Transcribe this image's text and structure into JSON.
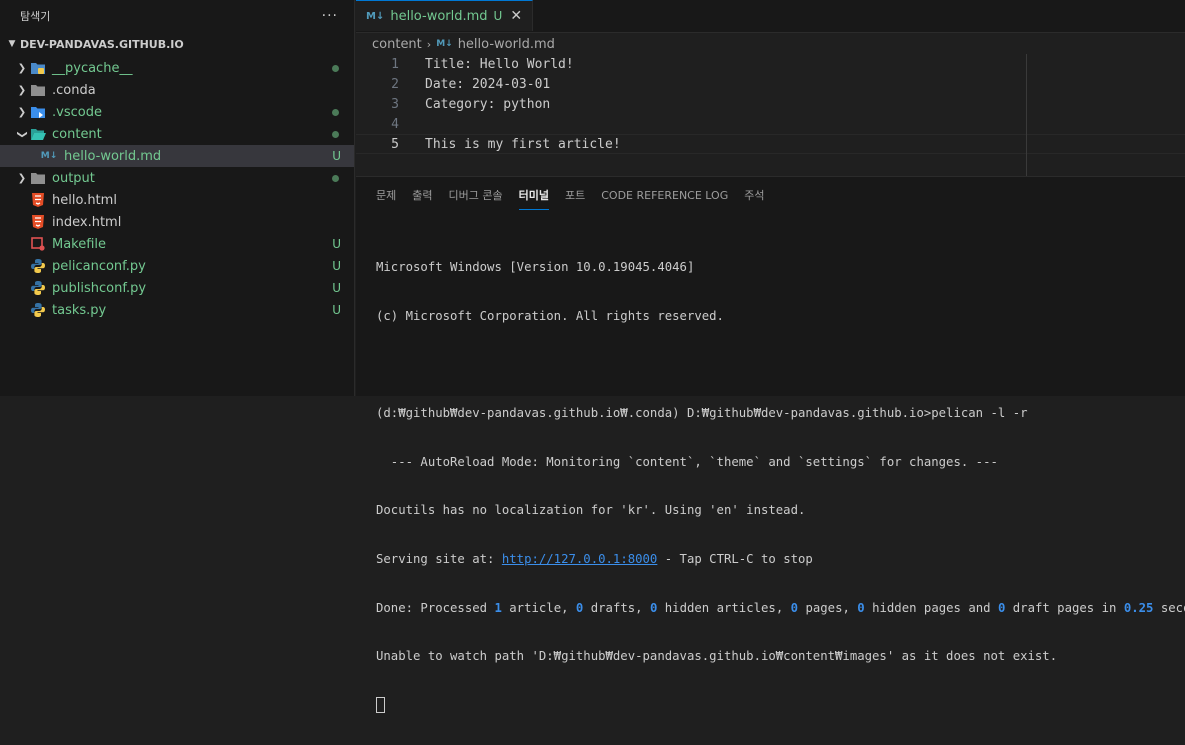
{
  "explorer": {
    "title": "탐색기",
    "more": "···",
    "root": "DEV-PANDAVAS.GITHUB.IO",
    "items": [
      {
        "label": "__pycache__",
        "type": "folder",
        "icon": "folder-python-icon",
        "status": "dot",
        "color": "#73c991"
      },
      {
        "label": ".conda",
        "type": "folder",
        "icon": "folder-icon",
        "status": "",
        "color": "#cccccc"
      },
      {
        "label": ".vscode",
        "type": "folder",
        "icon": "folder-vscode-icon",
        "status": "dot",
        "color": "#73c991"
      },
      {
        "label": "content",
        "type": "folder-open",
        "icon": "folder-open-icon",
        "status": "dot",
        "color": "#73c991"
      },
      {
        "label": "hello-world.md",
        "type": "file",
        "icon": "markdown-icon",
        "status": "U",
        "color": "#73c991"
      },
      {
        "label": "output",
        "type": "folder",
        "icon": "folder-icon",
        "status": "dot",
        "color": "#73c991"
      },
      {
        "label": "hello.html",
        "type": "file",
        "icon": "html-icon",
        "status": "",
        "color": "#cccccc"
      },
      {
        "label": "index.html",
        "type": "file",
        "icon": "html-icon",
        "status": "",
        "color": "#cccccc"
      },
      {
        "label": "Makefile",
        "type": "file",
        "icon": "makefile-icon",
        "status": "U",
        "color": "#73c991"
      },
      {
        "label": "pelicanconf.py",
        "type": "file",
        "icon": "python-icon",
        "status": "U",
        "color": "#73c991"
      },
      {
        "label": "publishconf.py",
        "type": "file",
        "icon": "python-icon",
        "status": "U",
        "color": "#73c991"
      },
      {
        "label": "tasks.py",
        "type": "file",
        "icon": "python-icon",
        "status": "U",
        "color": "#73c991"
      }
    ]
  },
  "editor": {
    "tab": {
      "icon": "M↓",
      "label": "hello-world.md",
      "status": "U",
      "close": "✕"
    },
    "breadcrumb": {
      "folder": "content",
      "sep": "›",
      "icon": "M↓",
      "file": "hello-world.md"
    },
    "lines": [
      {
        "num": "1",
        "text": "Title: Hello World!"
      },
      {
        "num": "2",
        "text": "Date: 2024-03-01"
      },
      {
        "num": "3",
        "text": "Category: python"
      },
      {
        "num": "4",
        "text": ""
      },
      {
        "num": "5",
        "text": "This is my first article!"
      }
    ]
  },
  "panel": {
    "tabs": [
      "문제",
      "출력",
      "디버그 콘솔",
      "터미널",
      "포트",
      "CODE REFERENCE LOG",
      "주석"
    ],
    "active_tab": "터미널",
    "terminal": {
      "l1": "Microsoft Windows [Version 10.0.19045.4046]",
      "l2": "(c) Microsoft Corporation. All rights reserved.",
      "l3": "(d:₩github₩dev-pandavas.github.io₩.conda) D:₩github₩dev-pandavas.github.io>pelican -l -r",
      "l4": "  --- AutoReload Mode: Monitoring `content`, `theme` and `settings` for changes. ---",
      "l5": "Docutils has no localization for 'kr'. Using 'en' instead.",
      "l6_pre": "Serving site at: ",
      "l6_link": "http://127.0.0.1:8000",
      "l6_post": " - Tap CTRL-C to stop",
      "l7": {
        "a": "Done: Processed ",
        "n1": "1",
        "b": " article, ",
        "n2": "0",
        "c": " drafts, ",
        "n3": "0",
        "d": " hidden articles, ",
        "n4": "0",
        "e": " pages, ",
        "n5": "0",
        "f": " hidden pages and ",
        "n6": "0",
        "g": " draft pages in ",
        "n7": "0.25",
        "h": " seconds."
      },
      "l8": "Unable to watch path 'D:₩github₩dev-pandavas.github.io₩content₩images' as it does not exist."
    }
  }
}
